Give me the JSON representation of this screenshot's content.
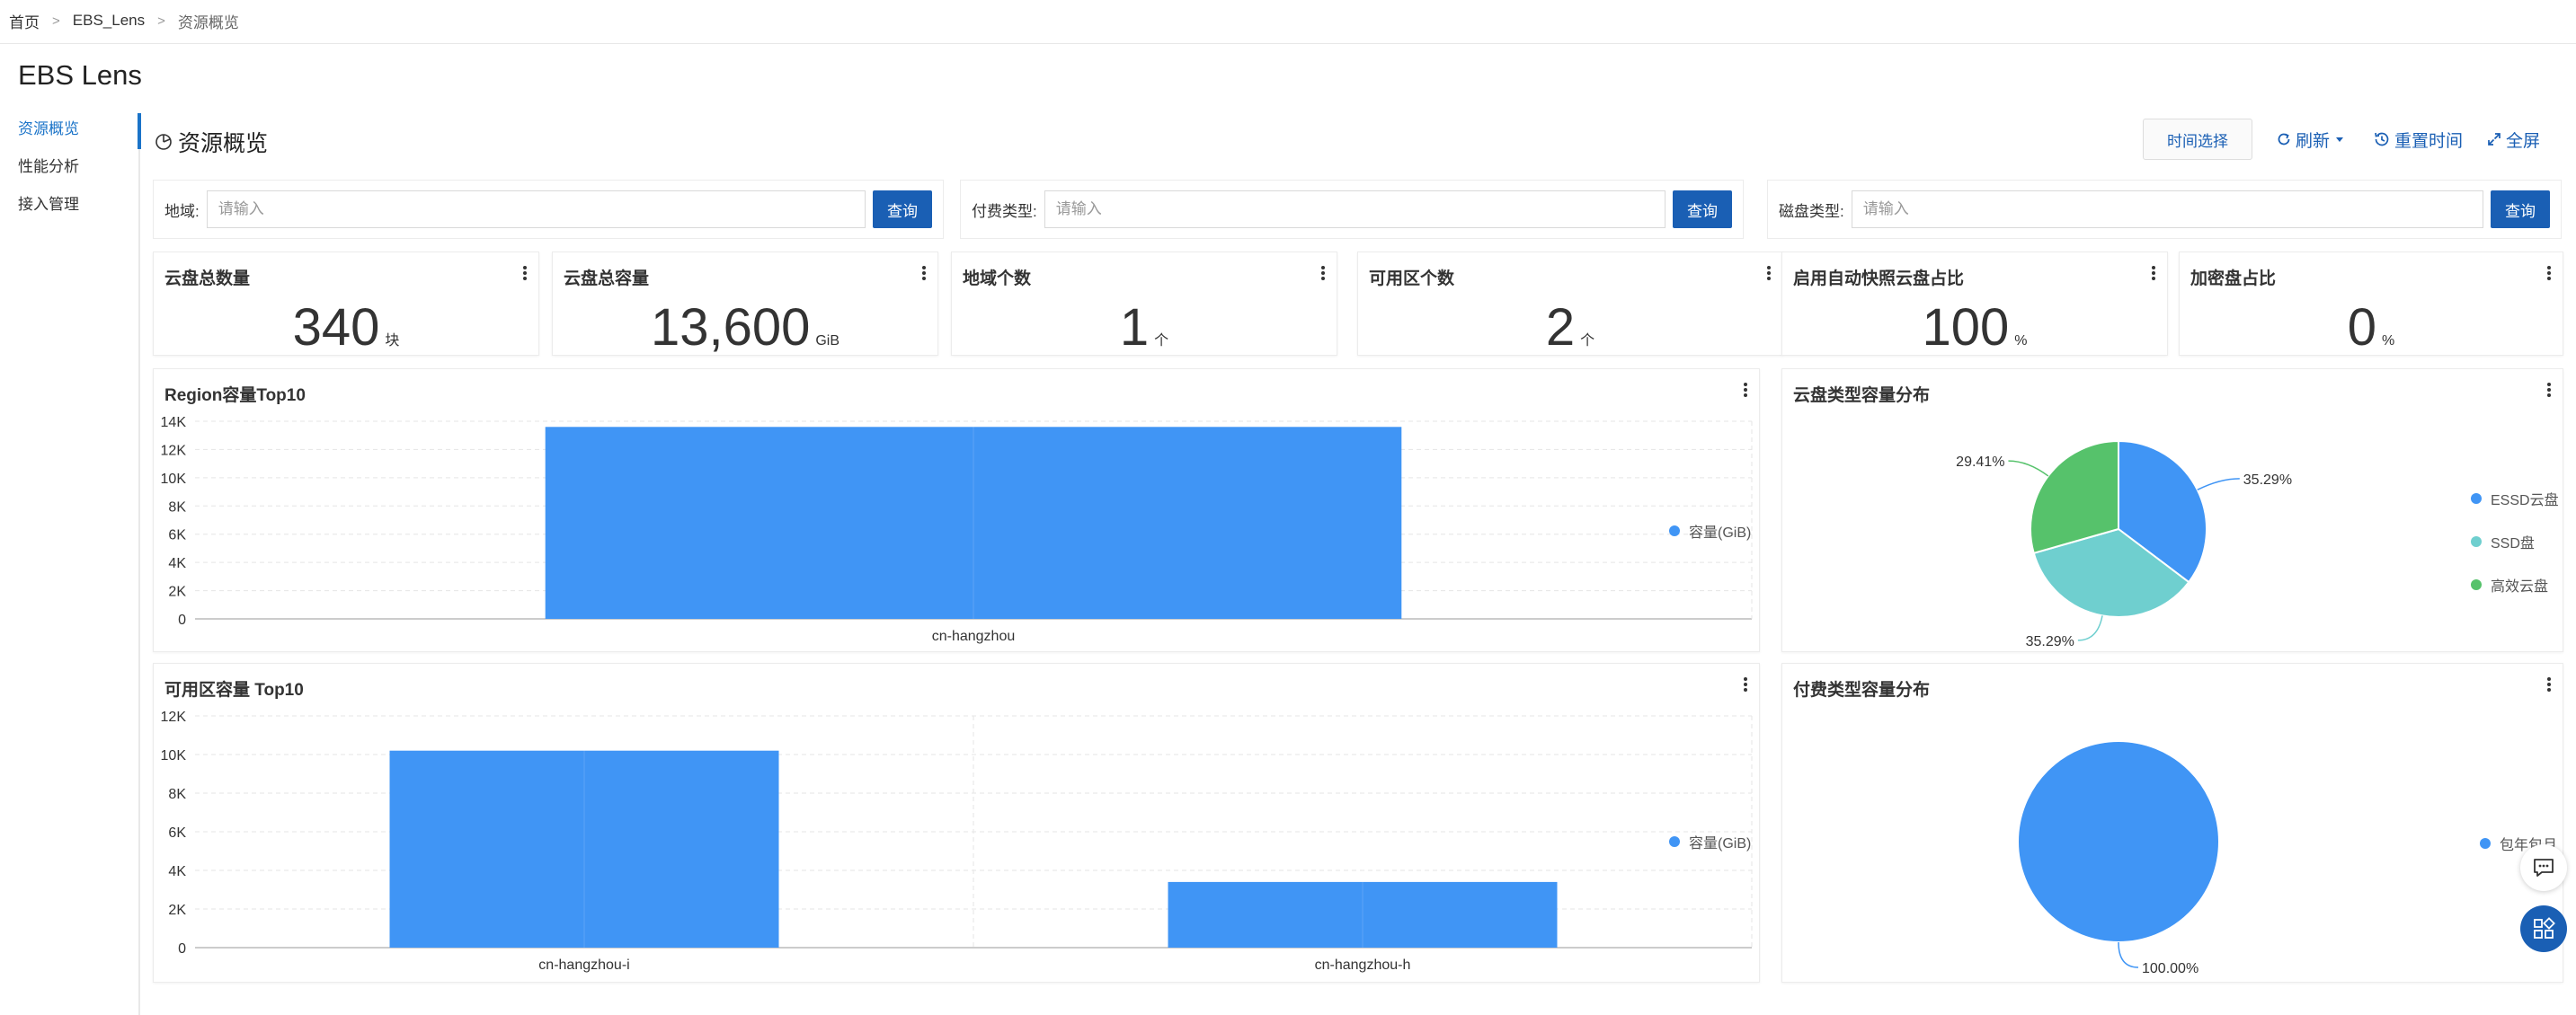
{
  "breadcrumb": {
    "home": "首页",
    "parent": "EBS_Lens",
    "current": "资源概览"
  },
  "app": {
    "title": "EBS Lens"
  },
  "sidebar": {
    "items": [
      {
        "label": "资源概览",
        "active": true
      },
      {
        "label": "性能分析",
        "active": false
      },
      {
        "label": "接入管理",
        "active": false
      }
    ]
  },
  "page": {
    "title": "资源概览"
  },
  "toolbar": {
    "time_select": "时间选择",
    "refresh": "刷新",
    "reset_time": "重置时间",
    "fullscreen": "全屏"
  },
  "filters": [
    {
      "label": "地域:",
      "placeholder": "请输入",
      "button": "查询"
    },
    {
      "label": "付费类型:",
      "placeholder": "请输入",
      "button": "查询"
    },
    {
      "label": "磁盘类型:",
      "placeholder": "请输入",
      "button": "查询"
    }
  ],
  "stats": [
    {
      "title": "云盘总数量",
      "value": "340",
      "unit": "块"
    },
    {
      "title": "云盘总容量",
      "value": "13,600",
      "unit": "GiB"
    },
    {
      "title": "地域个数",
      "value": "1",
      "unit": "个"
    },
    {
      "title": "可用区个数",
      "value": "2",
      "unit": "个"
    },
    {
      "title": "启用自动快照云盘占比",
      "value": "100",
      "unit": "%"
    },
    {
      "title": "加密盘占比",
      "value": "0",
      "unit": "%"
    }
  ],
  "colors": {
    "accent": "#1a5fb4",
    "bar": "#4095f5",
    "pie_blue": "#4095f5",
    "pie_teal": "#6fcfcf",
    "pie_green": "#56c26b"
  },
  "chart_data": [
    {
      "type": "bar",
      "title": "Region容量Top10",
      "categories": [
        "cn-hangzhou"
      ],
      "series": [
        {
          "name": "容量(GiB)",
          "values": [
            13600
          ]
        }
      ],
      "ylim": [
        0,
        14000
      ],
      "yticks": [
        "0",
        "2K",
        "4K",
        "6K",
        "8K",
        "10K",
        "12K",
        "14K"
      ],
      "grid": true,
      "legend": "right"
    },
    {
      "type": "pie",
      "title": "云盘类型容量分布",
      "slices": [
        {
          "label": "ESSD云盘",
          "value": 35.29,
          "display": "35.29%"
        },
        {
          "label": "SSD盘",
          "value": 35.29,
          "display": "35.29%"
        },
        {
          "label": "高效云盘",
          "value": 29.41,
          "display": "29.41%"
        }
      ],
      "legend": "right"
    },
    {
      "type": "bar",
      "title": "可用区容量 Top10",
      "categories": [
        "cn-hangzhou-i",
        "cn-hangzhou-h"
      ],
      "series": [
        {
          "name": "容量(GiB)",
          "values": [
            10200,
            3400
          ]
        }
      ],
      "ylim": [
        0,
        12000
      ],
      "yticks": [
        "0",
        "2K",
        "4K",
        "6K",
        "8K",
        "10K",
        "12K"
      ],
      "grid": true,
      "legend": "right"
    },
    {
      "type": "pie",
      "title": "付费类型容量分布",
      "slices": [
        {
          "label": "包年包月",
          "value": 100,
          "display": "100.00%"
        }
      ],
      "legend": "right"
    }
  ]
}
